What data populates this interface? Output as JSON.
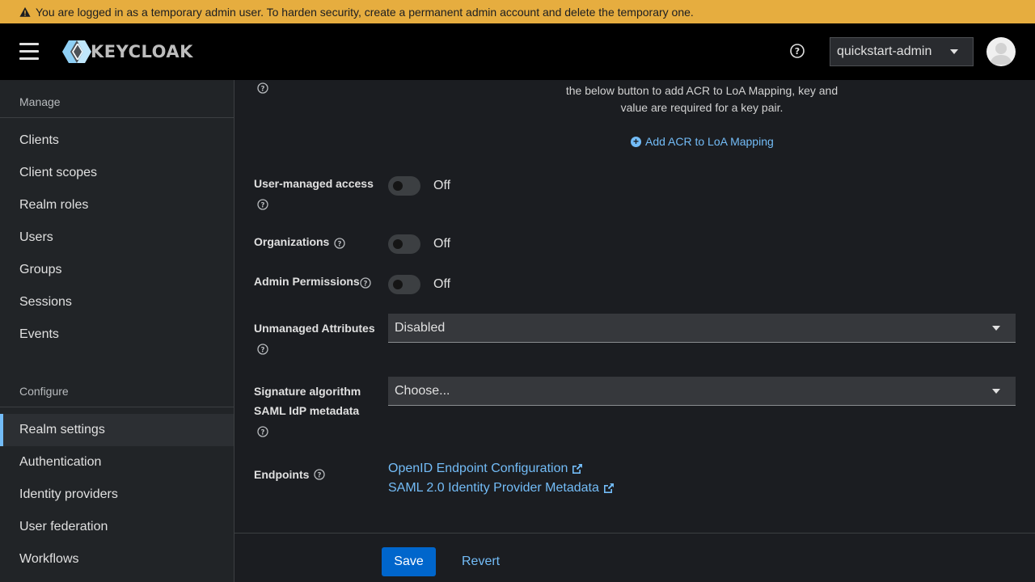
{
  "banner": {
    "text": "You are logged in as a temporary admin user. To harden security, create a permanent admin account and delete the temporary one."
  },
  "header": {
    "logo_text": "KEYCLOAK",
    "user": "quickstart-admin"
  },
  "sidebar": {
    "manage_title": "Manage",
    "manage_items": [
      "Clients",
      "Client scopes",
      "Realm roles",
      "Users",
      "Groups",
      "Sessions",
      "Events"
    ],
    "configure_title": "Configure",
    "configure_items": [
      "Realm settings",
      "Authentication",
      "Identity providers",
      "User federation",
      "Workflows"
    ],
    "active_item": "Realm settings"
  },
  "main": {
    "acr_help_line1": "the below button to add ACR to LoA Mapping, key and",
    "acr_help_line2": "value are required for a key pair.",
    "add_acr_label": "Add ACR to LoA Mapping",
    "user_managed_access": {
      "label": "User-managed access",
      "state": "Off"
    },
    "organizations": {
      "label": "Organizations",
      "state": "Off"
    },
    "admin_permissions": {
      "label": "Admin Permissions",
      "state": "Off"
    },
    "unmanaged_attributes": {
      "label": "Unmanaged Attributes",
      "value": "Disabled"
    },
    "signature_algorithm": {
      "label_line1": "Signature algorithm",
      "label_line2": "SAML IdP metadata",
      "value": "Choose..."
    },
    "endpoints": {
      "label": "Endpoints",
      "links": [
        "OpenID Endpoint Configuration",
        "SAML 2.0 Identity Provider Metadata"
      ]
    }
  },
  "footer": {
    "save_label": "Save",
    "revert_label": "Revert"
  },
  "colors": {
    "banner": "#e6ad3f",
    "accent": "#73bcf7",
    "primary_button": "#0066cc"
  }
}
